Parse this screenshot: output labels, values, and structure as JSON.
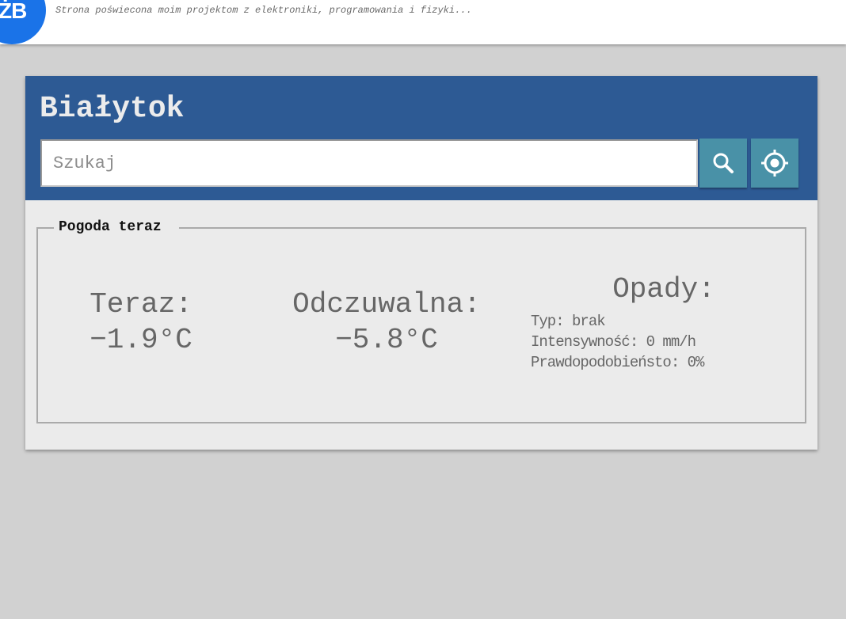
{
  "header": {
    "logo_text": "ŻB",
    "tagline": "Strona poświecona moim projektom z elektroniki, programowania i fizyki..."
  },
  "card": {
    "city": "Białytok",
    "search": {
      "placeholder": "Szukaj",
      "value": ""
    },
    "buttons": {
      "search_icon": "search-icon",
      "locate_icon": "crosshair-icon"
    },
    "colors": {
      "header_bg": "#2d5a94",
      "button_bg": "#4991a7",
      "logo_bg": "#1a73e8"
    }
  },
  "weather": {
    "section_title": "Pogoda teraz",
    "now_label": "Teraz:",
    "now_value": "−1.9°C",
    "feels_label": "Odczuwalna:",
    "feels_value": "−5.8°C",
    "precip_label": "Opady:",
    "precip_type": "Typ: brak",
    "precip_intensity": "Intensywność: 0 mm/h",
    "precip_probability": "Prawdopodobieństo: 0%"
  }
}
